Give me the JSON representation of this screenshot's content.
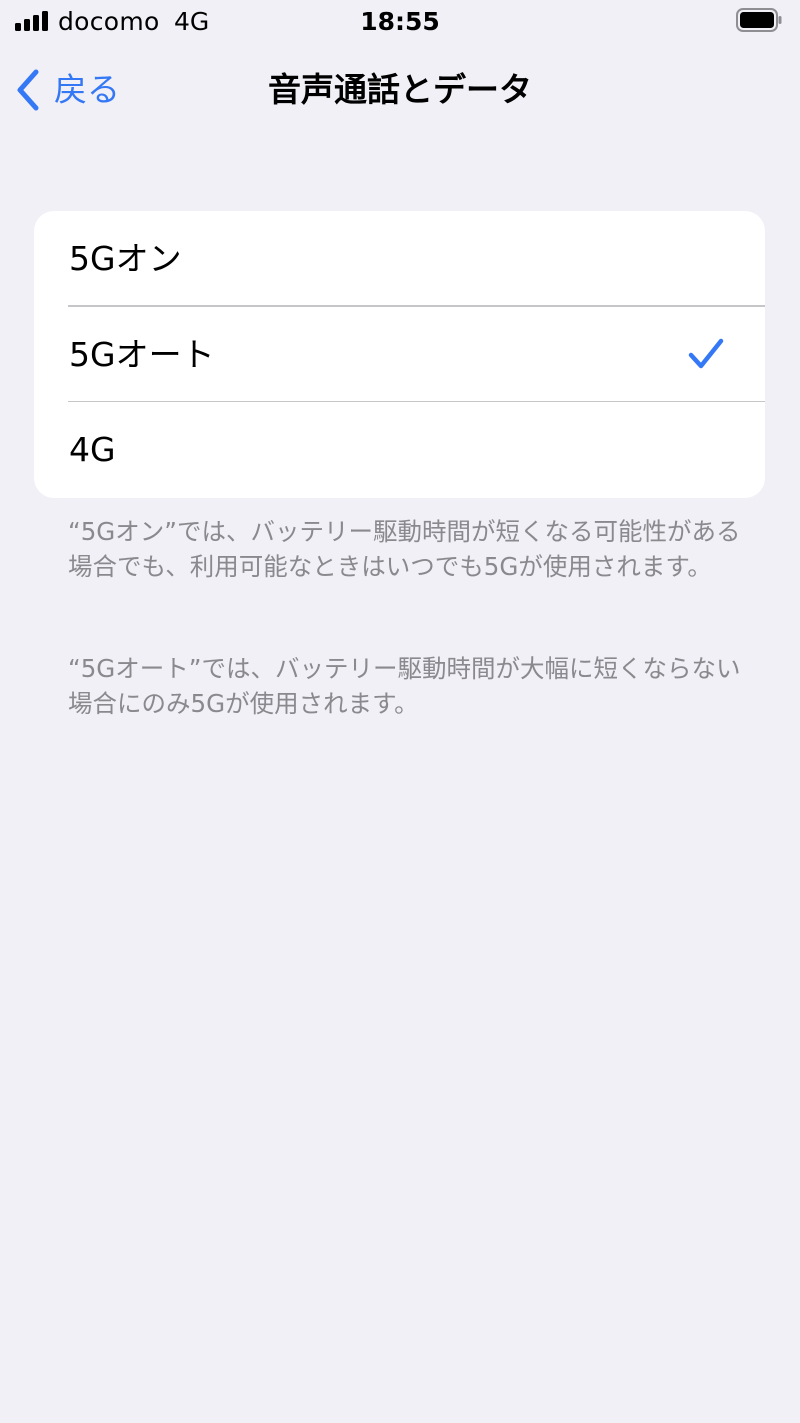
{
  "status_bar": {
    "carrier": "docomo",
    "network": "4G",
    "time": "18:55",
    "icons": [
      "signal-icon",
      "battery-icon"
    ]
  },
  "nav": {
    "back_label": "戻る",
    "back_icon": "chevron-left-icon",
    "title": "音声通話とデータ"
  },
  "options": [
    {
      "label": "5Gオン",
      "selected": false
    },
    {
      "label": "5Gオート",
      "selected": true
    },
    {
      "label": "4G",
      "selected": false
    }
  ],
  "footnotes": [
    "“5Gオン”では、バッテリー駆動時間が短くなる可能性がある場合でも、利用可能なときはいつでも5Gが使用されます。",
    "“5Gオート”では、バッテリー駆動時間が大幅に短くならない場合にのみ5Gが使用されます。"
  ],
  "colors": {
    "accent": "#3478f6",
    "background": "#f1f0f6",
    "secondary_text": "#8a8a8e"
  }
}
